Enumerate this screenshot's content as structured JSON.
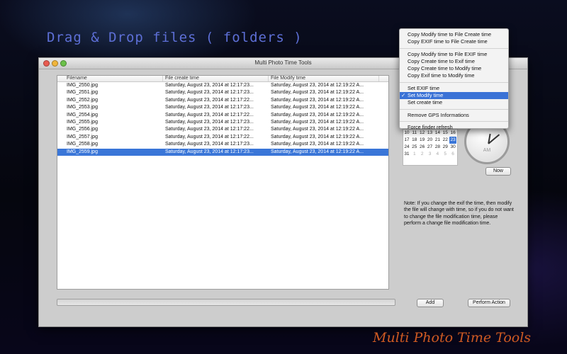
{
  "overlay": {
    "drop_hint": "Drag & Drop files ( folders )",
    "brand_caption": "Multi Photo Time Tools"
  },
  "window": {
    "title": "Multi Photo Time Tools"
  },
  "table": {
    "columns": [
      "Filename",
      "File create time",
      "File Modify time"
    ],
    "rows": [
      {
        "filename": "IMG_2550.jpg",
        "created": "Saturday, August 23, 2014 at 12:17:23...",
        "modified": "Saturday, August 23, 2014 at 12:19:22 A..."
      },
      {
        "filename": "IMG_2551.jpg",
        "created": "Saturday, August 23, 2014 at 12:17:23...",
        "modified": "Saturday, August 23, 2014 at 12:19:22 A..."
      },
      {
        "filename": "IMG_2552.jpg",
        "created": "Saturday, August 23, 2014 at 12:17:22...",
        "modified": "Saturday, August 23, 2014 at 12:19:22 A..."
      },
      {
        "filename": "IMG_2553.jpg",
        "created": "Saturday, August 23, 2014 at 12:17:23...",
        "modified": "Saturday, August 23, 2014 at 12:19:22 A..."
      },
      {
        "filename": "IMG_2554.jpg",
        "created": "Saturday, August 23, 2014 at 12:17:22...",
        "modified": "Saturday, August 23, 2014 at 12:19:22 A..."
      },
      {
        "filename": "IMG_2555.jpg",
        "created": "Saturday, August 23, 2014 at 12:17:23...",
        "modified": "Saturday, August 23, 2014 at 12:19:22 A..."
      },
      {
        "filename": "IMG_2556.jpg",
        "created": "Saturday, August 23, 2014 at 12:17:22...",
        "modified": "Saturday, August 23, 2014 at 12:19:22 A..."
      },
      {
        "filename": "IMG_2557.jpg",
        "created": "Saturday, August 23, 2014 at 12:17:22...",
        "modified": "Saturday, August 23, 2014 at 12:19:22 A..."
      },
      {
        "filename": "IMG_2558.jpg",
        "created": "Saturday, August 23, 2014 at 12:17:23...",
        "modified": "Saturday, August 23, 2014 at 12:19:22 A..."
      },
      {
        "filename": "IMG_2559.jpg",
        "created": "Saturday, August 23, 2014 at 12:17:23...",
        "modified": "Saturday, August 23, 2014 at 12:19:22 A..."
      }
    ],
    "selected_row": 9
  },
  "calendar": {
    "rows": [
      [
        "10",
        "11",
        "12",
        "13",
        "14",
        "15",
        "16"
      ],
      [
        "17",
        "18",
        "19",
        "20",
        "21",
        "22",
        "23"
      ],
      [
        "24",
        "25",
        "26",
        "27",
        "28",
        "29",
        "30"
      ],
      [
        "31",
        "1",
        "2",
        "3",
        "4",
        "5",
        "6"
      ]
    ],
    "selected_day": "23"
  },
  "clock": {
    "period": "AM"
  },
  "buttons": {
    "now": "Now",
    "add": "Add",
    "perform": "Perform Action"
  },
  "note": "Note:  If you change the exif the time, then modify the file will change with time, so if you do not want to change the file modification time, please perform a change file modification time.",
  "menu": {
    "groups": [
      [
        "Copy Modify time to File Create time",
        "Copy EXIF time to File Create time"
      ],
      [
        "Copy Modify time to File EXIF time",
        "Copy Create time to Exif time",
        "Copy Create time to Modify time",
        "Copy Exif time to Modify time"
      ],
      [
        "Set EXIF time",
        "Set Modify time",
        "Set create time"
      ],
      [
        "Remove GPS Informations"
      ],
      [
        "Force finder refresh"
      ]
    ],
    "checked_item": "Set Modify time",
    "check_mark": "✓"
  },
  "colors": {
    "selection": "#3a76d8",
    "drop_hint": "#5d6fd6",
    "brand": "#cf5a22"
  }
}
